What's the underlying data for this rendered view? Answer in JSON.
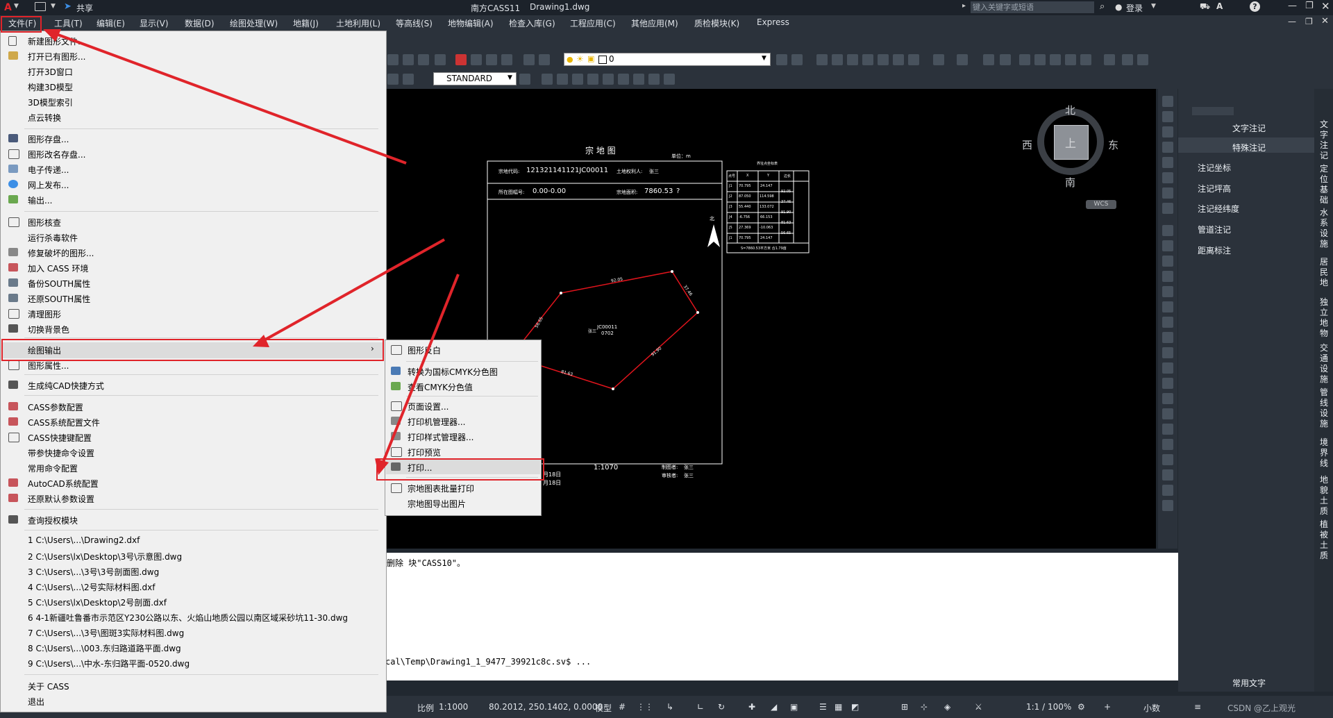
{
  "app": {
    "title": "南方CASS11",
    "document": "Drawing1.dwg",
    "share_label": "共享",
    "search_placeholder": "键入关键字或短语",
    "login_label": "登录"
  },
  "menubar": [
    "文件(F)",
    "工具(T)",
    "编辑(E)",
    "显示(V)",
    "数据(D)",
    "绘图处理(W)",
    "地籍(J)",
    "土地利用(L)",
    "等高线(S)",
    "地物编辑(A)",
    "检查入库(G)",
    "工程应用(C)",
    "其他应用(M)",
    "质检模块(K)",
    "Express"
  ],
  "toolbar": {
    "layer_value": "0",
    "textstyle_value": "STANDARD"
  },
  "file_menu": {
    "items": [
      "新建图形文件...",
      "打开已有图形...",
      "打开3D窗口",
      "构建3D模型",
      "3D模型索引",
      "点云转换",
      "图形存盘...",
      "图形改名存盘...",
      "电子传递...",
      "网上发布...",
      "输出...",
      "图形核查",
      "运行杀毒软件",
      "修复破坏的图形...",
      "加入 CASS 环境",
      "备份SOUTH属性",
      "还原SOUTH属性",
      "清理图形",
      "切换背景色",
      "绘图输出",
      "图形属性...",
      "生成纯CAD快捷方式",
      "CASS参数配置",
      "CASS系统配置文件",
      "CASS快捷键配置",
      "带参快捷命令设置",
      "常用命令配置",
      "AutoCAD系统配置",
      "还原默认参数设置",
      "查询授权模块",
      "1 C:\\Users\\...\\Drawing2.dxf",
      "2 C:\\Users\\lx\\Desktop\\3号\\示意图.dwg",
      "3 C:\\Users\\...\\3号\\3号剖面图.dwg",
      "4 C:\\Users\\...\\2号实际材料图.dxf",
      "5 C:\\Users\\lx\\Desktop\\2号剖面.dxf",
      "6 4-1新疆吐鲁番市示范区Y230公路以东、火焰山地质公园以南区域采砂坑11-30.dwg",
      "7 C:\\Users\\...\\3号\\图斑3实际材料图.dwg",
      "8 C:\\Users\\...\\003.东归路道路平面.dwg",
      "9 C:\\Users\\...\\中水-东归路平面-0520.dwg",
      "关于 CASS",
      "退出"
    ]
  },
  "submenu": {
    "items": [
      "图形反白",
      "转换为国标CMYK分色图",
      "查看CMYK分色值",
      "页面设置...",
      "打印机管理器...",
      "打印样式管理器...",
      "打印预览",
      "打印...",
      "宗地图表批量打印",
      "宗地图导出图片"
    ]
  },
  "drawing": {
    "title": "宗 地 图",
    "unit": "单位：m",
    "parcel_code_label": "宗地代码:",
    "parcel_code": "121321141121JC00011",
    "owner_label": "土地权利人:",
    "owner": "张三",
    "sheet_label": "所在图幅号:",
    "sheet": "0.00-0.00",
    "area_label": "宗地面积:",
    "area": "7860.53",
    "area_suffix": "?",
    "north_char": "北",
    "polygon_label1": "JC00011",
    "polygon_label2": "0702",
    "polygon_prefix": "张三",
    "scale": "1:1070",
    "drafter_label": "制图者:",
    "drafter": "张三",
    "reviewer_label": "审核者:",
    "reviewer": "张三",
    "date1": "月18日",
    "date2": "月18日",
    "edge_labels": [
      "92.05",
      "37.46",
      "91.90",
      "81.63",
      "56.65"
    ],
    "coord_table_title": "界址点坐标表",
    "coord_table_headers": [
      "点号",
      "X",
      "Y",
      "边长"
    ],
    "coord_rows": [
      [
        "J1",
        "70.795",
        "24.147",
        ""
      ],
      [
        "J2",
        "87.050",
        "114.598",
        "92.05"
      ],
      [
        "J3",
        "55.440",
        "133.072",
        "37.46"
      ],
      [
        "J4",
        "-6.756",
        "66.153",
        "91.90"
      ],
      [
        "J5",
        "27.369",
        "-10.063",
        "81.63"
      ],
      [
        "J1",
        "70.795",
        "24.147",
        "56.65"
      ]
    ],
    "coord_footer": "S=7860.53平方米 合1.79亩"
  },
  "viewcube": {
    "north": "北",
    "south": "南",
    "east": "东",
    "west": "西",
    "top": "上",
    "wcs": "WCS"
  },
  "command": {
    "line1": "删除 块\"CASS10\"。",
    "line2": "cal\\Temp\\Drawing1_1_9477_39921c8c.sv$ ..."
  },
  "right_panel": {
    "top_items": [
      "文字注记",
      "特殊注记"
    ],
    "items": [
      "注记坐标",
      "注记坪高",
      "注记经纬度",
      "管道注记",
      "距离标注"
    ],
    "bottom_label": "常用文字",
    "tabs": [
      "文字注记",
      "定位基础",
      "水系设施",
      "居民地",
      "独立地物",
      "交通设施",
      "管线设施",
      "境界线",
      "地貌土质",
      "植被土质"
    ]
  },
  "status": {
    "scale_label": "比例",
    "scale_value": "1:1000",
    "coords": "80.2012, 250.1402, 0.0000",
    "model": "模型",
    "zoom": "1:1 / 100%",
    "units": "小数",
    "watermark": "CSDN @乙上观光"
  }
}
